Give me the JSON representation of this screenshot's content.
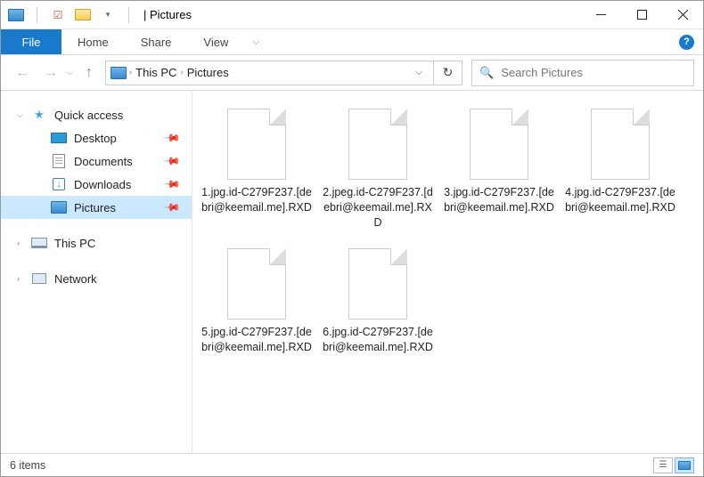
{
  "title_prefix": "| ",
  "title": "Pictures",
  "ribbon": {
    "file": "File",
    "tabs": [
      "Home",
      "Share",
      "View"
    ]
  },
  "breadcrumb": {
    "segments": [
      "This PC",
      "Pictures"
    ]
  },
  "search": {
    "placeholder": "Search Pictures"
  },
  "sidebar": {
    "quick": "Quick access",
    "quick_items": [
      {
        "label": "Desktop",
        "icon": "desktop"
      },
      {
        "label": "Documents",
        "icon": "documents"
      },
      {
        "label": "Downloads",
        "icon": "downloads"
      },
      {
        "label": "Pictures",
        "icon": "pictures",
        "active": true
      }
    ],
    "thispc": "This PC",
    "network": "Network"
  },
  "files": [
    {
      "name": "1.jpg.id-C279F237.[debri@keemail.me].RXD"
    },
    {
      "name": "2.jpeg.id-C279F237.[debri@keemail.me].RXD"
    },
    {
      "name": "3.jpg.id-C279F237.[debri@keemail.me].RXD"
    },
    {
      "name": "4.jpg.id-C279F237.[debri@keemail.me].RXD"
    },
    {
      "name": "5.jpg.id-C279F237.[debri@keemail.me].RXD"
    },
    {
      "name": "6.jpg.id-C279F237.[debri@keemail.me].RXD"
    }
  ],
  "status": {
    "count": "6 items"
  }
}
